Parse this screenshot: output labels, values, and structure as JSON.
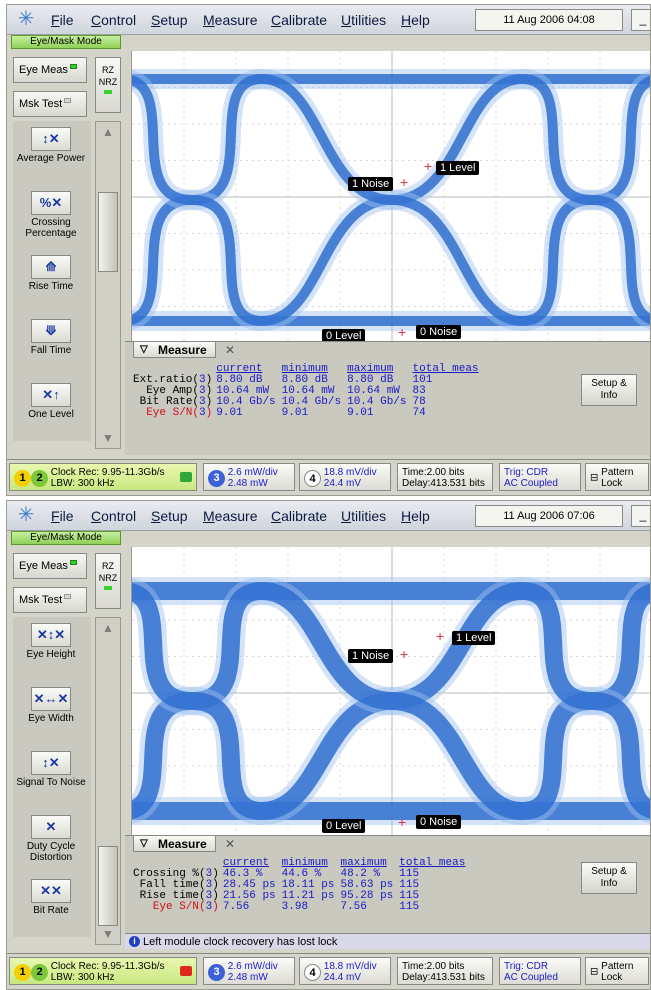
{
  "screens": [
    {
      "menu": [
        "File",
        "Control",
        "Setup",
        "Measure",
        "Calibrate",
        "Utilities",
        "Help"
      ],
      "datetime": "11 Aug 2006  04:08",
      "minimize": "_",
      "mode_label": "Eye/Mask Mode",
      "eye_meas": "Eye Meas",
      "msk_test": "Msk Test",
      "rz_nrz": [
        "RZ",
        "NRZ"
      ],
      "measurements": [
        {
          "label": "Average Power",
          "icon": "average-power-icon"
        },
        {
          "label": "Crossing Percentage",
          "icon": "crossing-percentage-icon"
        },
        {
          "label": "Rise Time",
          "icon": "rise-time-icon"
        },
        {
          "label": "Fall Time",
          "icon": "fall-time-icon"
        },
        {
          "label": "One Level",
          "icon": "one-level-icon"
        }
      ],
      "markers": [
        "1 Level",
        "1 Noise",
        "0 Level",
        "0 Noise"
      ],
      "measure_title": "Measure",
      "table": {
        "headers": [
          "current",
          "minimum",
          "maximum",
          "total meas"
        ],
        "rows": [
          {
            "name": "Ext.ratio",
            "ch": "3",
            "current": "8.80 dB",
            "minimum": "8.80 dB",
            "maximum": "8.80 dB",
            "total": "101",
            "red": false
          },
          {
            "name": "Eye Amp",
            "ch": "3",
            "current": "10.64 mW",
            "minimum": "10.64 mW",
            "maximum": "10.64 mW",
            "total": "83",
            "red": false
          },
          {
            "name": "Bit Rate",
            "ch": "3",
            "current": "10.4 Gb/s",
            "minimum": "10.4 Gb/s",
            "maximum": "10.4 Gb/s",
            "total": "78",
            "red": false
          },
          {
            "name": "Eye S/N",
            "ch": "3",
            "current": "9.01",
            "minimum": "9.01",
            "maximum": "9.01",
            "total": "74",
            "red": true
          }
        ]
      },
      "setup_info": "Setup & Info",
      "status": "",
      "bottom": {
        "ch12": [
          "1",
          "2"
        ],
        "clock_rec": "Clock Rec: 9.95-11.3Gb/s",
        "lbw": "LBW: 300 kHz",
        "ch3": "3",
        "ch3_scale": "2.6 mW/div",
        "ch3_offset": "2.48 mW",
        "ch4": "4",
        "ch4_scale": "18.8 mV/div",
        "ch4_offset": "24.4 mV",
        "time": "Time:2.00 bits",
        "delay": "Delay:413.531 bits",
        "trig": "Trig: CDR",
        "coupling": "AC Coupled",
        "pattern": "Pattern",
        "lock": "Lock"
      }
    },
    {
      "menu": [
        "File",
        "Control",
        "Setup",
        "Measure",
        "Calibrate",
        "Utilities",
        "Help"
      ],
      "datetime": "11 Aug 2006  07:06",
      "minimize": "_",
      "mode_label": "Eye/Mask Mode",
      "eye_meas": "Eye Meas",
      "msk_test": "Msk Test",
      "rz_nrz": [
        "RZ",
        "NRZ"
      ],
      "measurements": [
        {
          "label": "Eye Height",
          "icon": "eye-height-icon"
        },
        {
          "label": "Eye Width",
          "icon": "eye-width-icon"
        },
        {
          "label": "Signal To Noise",
          "icon": "signal-to-noise-icon"
        },
        {
          "label": "Duty Cycle Distortion",
          "icon": "duty-cycle-distortion-icon"
        },
        {
          "label": "Bit Rate",
          "icon": "bit-rate-icon"
        }
      ],
      "markers": [
        "1 Level",
        "1 Noise",
        "0 Level",
        "0 Noise"
      ],
      "measure_title": "Measure",
      "table": {
        "headers": [
          "current",
          "minimum",
          "maximum",
          "total meas"
        ],
        "rows": [
          {
            "name": "Crossing %",
            "ch": "3",
            "current": "46.3 %",
            "minimum": "44.6 %",
            "maximum": "48.2 %",
            "total": "115",
            "red": false
          },
          {
            "name": "Fall time",
            "ch": "3",
            "current": "28.45 ps",
            "minimum": "18.11 ps",
            "maximum": "58.63 ps",
            "total": "115",
            "red": false
          },
          {
            "name": "Rise time",
            "ch": "3",
            "current": "21.56 ps",
            "minimum": "11.21 ps",
            "maximum": "95.28 ps",
            "total": "115",
            "red": false
          },
          {
            "name": "Eye S/N",
            "ch": "3",
            "current": "7.56",
            "minimum": "3.98",
            "maximum": "7.56",
            "total": "115",
            "red": true
          }
        ]
      },
      "setup_info": "Setup & Info",
      "status": "Left module clock recovery has lost lock",
      "bottom": {
        "ch12": [
          "1",
          "2"
        ],
        "clock_rec": "Clock Rec: 9.95-11.3Gb/s",
        "lbw": "LBW: 300 kHz",
        "ch3": "3",
        "ch3_scale": "2.6 mW/div",
        "ch3_offset": "2.48 mW",
        "ch4": "4",
        "ch4_scale": "18.8 mV/div",
        "ch4_offset": "24.4 mV",
        "time": "Time:2.00 bits",
        "delay": "Delay:413.531 bits",
        "trig": "Trig: CDR",
        "coupling": "AC Coupled",
        "pattern": "Pattern",
        "lock": "Lock"
      }
    }
  ],
  "colors": {
    "eye_trace": "#2f6fd0",
    "eye_trace_light": "#9fc0f0",
    "marker_red": "#e0304a",
    "led_green": "#39d02f"
  }
}
